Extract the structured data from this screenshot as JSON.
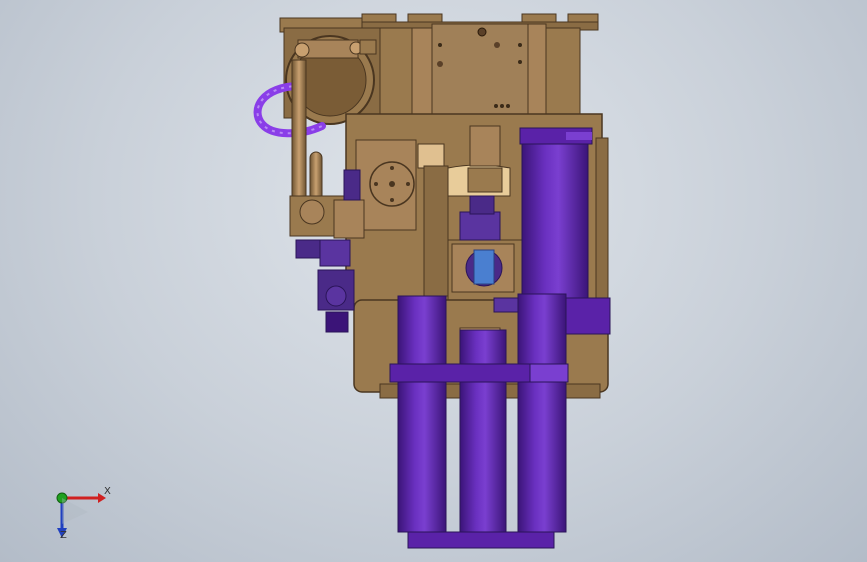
{
  "viewport": {
    "axes": {
      "x_label": "X",
      "z_label": "Z"
    },
    "colors": {
      "background_center": "#dfe4ea",
      "background_edge": "#b3bcc8",
      "frame_bronze": "#9a7a4e",
      "frame_bronze_light": "#b8956a",
      "frame_bronze_dark": "#6e5432",
      "cylinder_purple": "#5a22a8",
      "cylinder_purple_dark": "#3b1478",
      "cylinder_purple_light": "#7a3fd0",
      "hose_purple": "#8a3ee8",
      "valve_blue": "#4a7fd0",
      "axis_x": "#d02020",
      "axis_y": "#20a020",
      "axis_z": "#2040c0"
    }
  }
}
